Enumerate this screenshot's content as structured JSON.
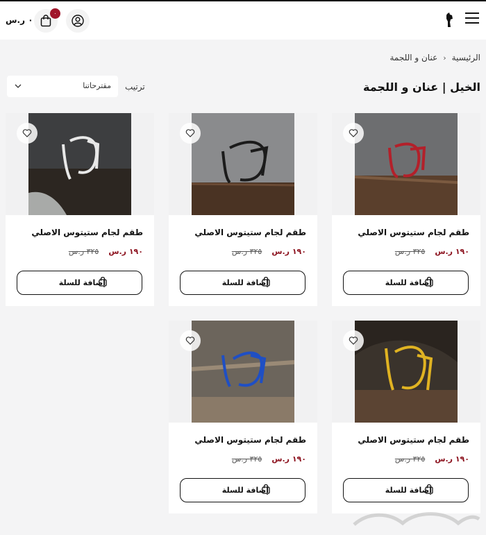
{
  "header": {
    "cart_total": "٠ ر.س",
    "cart_count": "٠",
    "icons": {
      "menu": "hamburger-menu-icon",
      "logo": "horse-head-logo",
      "cart": "shopping-bag-icon",
      "user": "user-account-icon"
    }
  },
  "breadcrumb": {
    "home": "الرئيسية",
    "current": "عنان و اللجمة"
  },
  "page": {
    "title": "الخيل | عنان و اللجمة"
  },
  "sort": {
    "label": "ترتيب",
    "value": "مقترحاتنا"
  },
  "products": [
    {
      "name": "طقم لجام ستيتوس الاصلي",
      "price": "١٩٠ ر.س",
      "old_price": "٣٢٥ ر.س",
      "add_label": "إضافة للسلة",
      "color": "#b3202a"
    },
    {
      "name": "طقم لجام ستيتوس الاصلي",
      "price": "١٩٠ ر.س",
      "old_price": "٣٢٥ ر.س",
      "add_label": "إضافة للسلة",
      "color": "#1b1b1b"
    },
    {
      "name": "طقم لجام ستيتوس الاصلي",
      "price": "١٩٠ ر.س",
      "old_price": "٣٢٥ ر.س",
      "add_label": "إضافة للسلة",
      "color": "#e8e8e8"
    },
    {
      "name": "طقم لجام ستيتوس الاصلي",
      "price": "١٩٠ ر.س",
      "old_price": "٣٢٥ ر.س",
      "add_label": "إضافة للسلة",
      "color": "#e0b322"
    },
    {
      "name": "طقم لجام ستيتوس الاصلي",
      "price": "١٩٠ ر.س",
      "old_price": "٣٢٥ ر.س",
      "add_label": "إضافة للسلة",
      "color": "#1f4fc4"
    }
  ],
  "colors": {
    "accent": "#8d1420",
    "badge": "#a0162b"
  }
}
